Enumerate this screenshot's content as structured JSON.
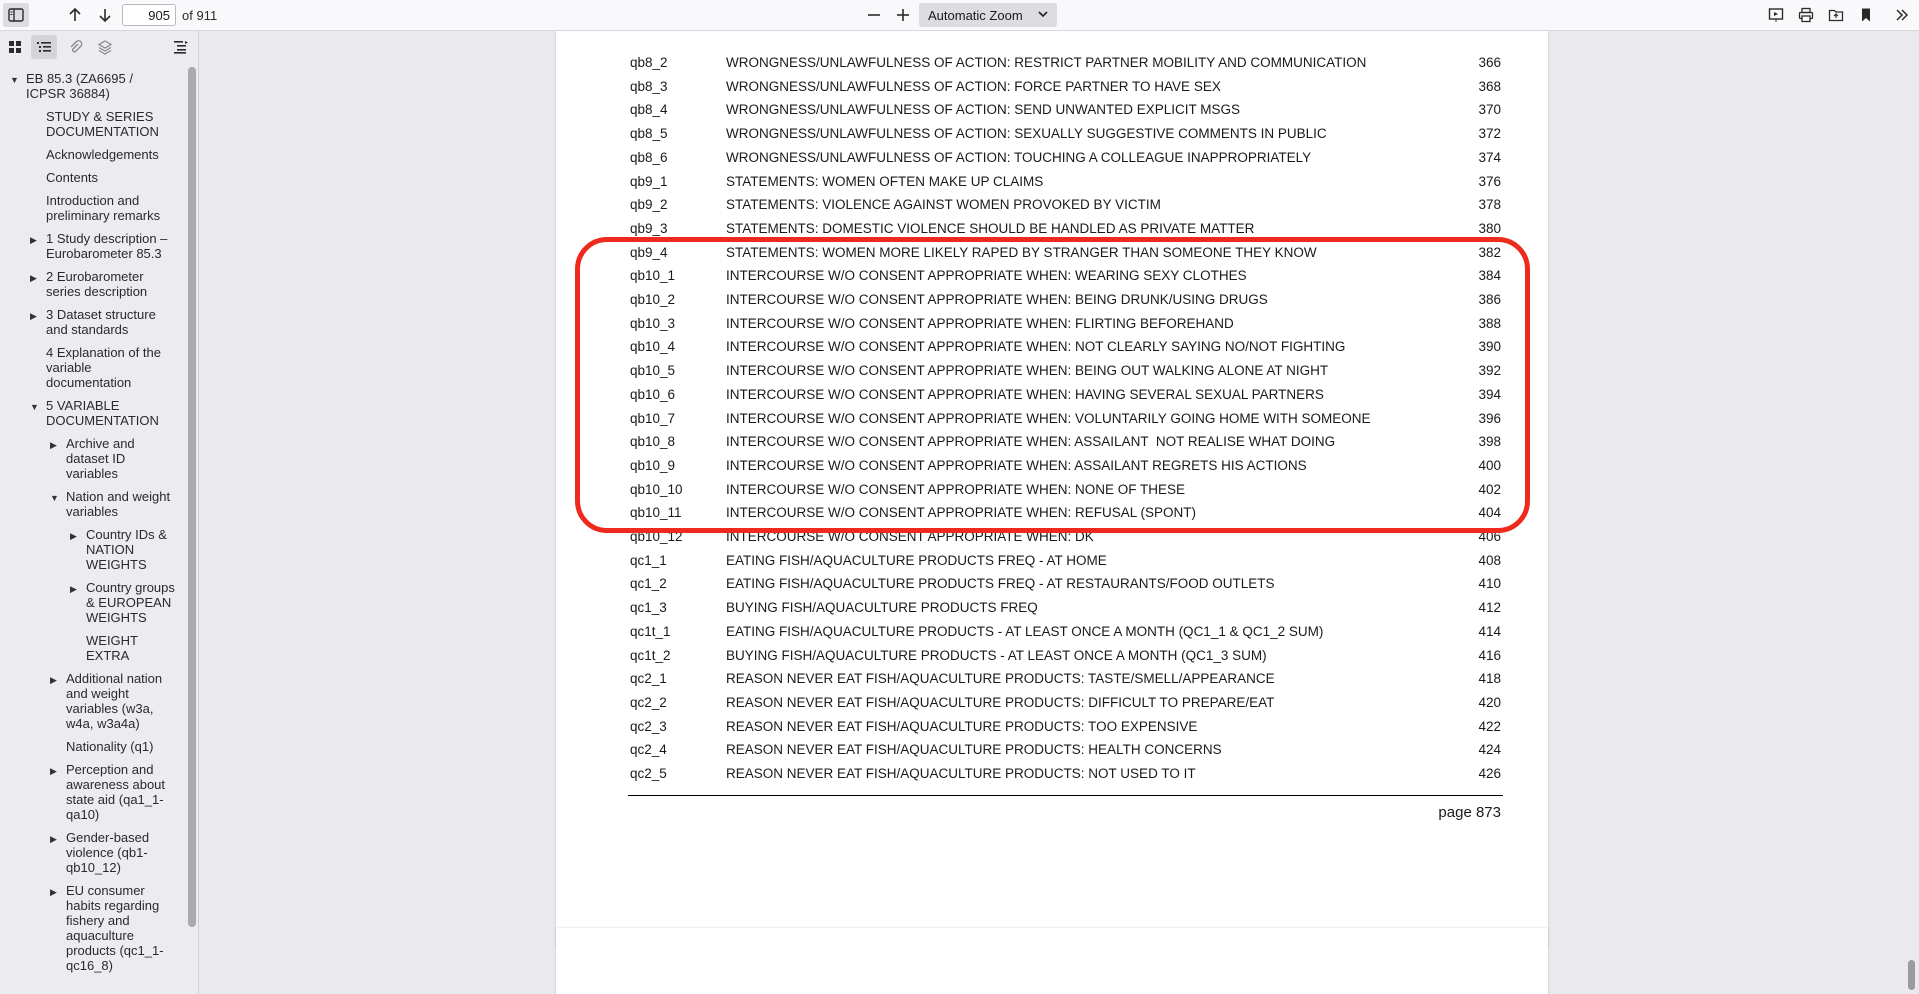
{
  "toolbar": {
    "page_number": "905",
    "page_count": "of 911",
    "zoom": "Automatic Zoom",
    "icons": {
      "sidebar_toggle": "sidebar-toggle-icon",
      "prev": "arrow-up-icon",
      "next": "arrow-down-icon",
      "zoom_out": "minus-icon",
      "zoom_in": "plus-icon",
      "presentation": "presentation-icon",
      "print": "print-icon",
      "open": "open-file-icon",
      "bookmark": "bookmark-icon",
      "tools": "double-chevron-icon"
    }
  },
  "sidebar": {
    "tabs": [
      "thumbnails-icon",
      "outline-icon",
      "attachments-icon",
      "layers-icon"
    ],
    "outline": [
      {
        "label": "EB 85.3 (ZA6695 / ICPSR 36884)",
        "level": 0,
        "twisty": "open"
      },
      {
        "label": "STUDY & SERIES DOCUMENTATION",
        "level": 1,
        "twisty": "none"
      },
      {
        "label": "Acknowledgements",
        "level": 1,
        "twisty": "none"
      },
      {
        "label": "Contents",
        "level": 1,
        "twisty": "none"
      },
      {
        "label": "Introduction and preliminary remarks",
        "level": 1,
        "twisty": "none"
      },
      {
        "label": "1 Study description – Eurobarometer 85.3",
        "level": 1,
        "twisty": "closed"
      },
      {
        "label": "2 Eurobarometer series description",
        "level": 1,
        "twisty": "closed"
      },
      {
        "label": "3 Dataset structure and standards",
        "level": 1,
        "twisty": "closed"
      },
      {
        "label": "4 Explanation of the variable documentation",
        "level": 1,
        "twisty": "none"
      },
      {
        "label": "5 VARIABLE DOCUMENTATION",
        "level": 1,
        "twisty": "open"
      },
      {
        "label": "Archive and dataset ID variables",
        "level": 2,
        "twisty": "closed"
      },
      {
        "label": "Nation and weight variables",
        "level": 2,
        "twisty": "open"
      },
      {
        "label": "Country IDs & NATION WEIGHTS",
        "level": 3,
        "twisty": "closed"
      },
      {
        "label": "Country groups & EUROPEAN WEIGHTS",
        "level": 3,
        "twisty": "closed"
      },
      {
        "label": "WEIGHT EXTRA",
        "level": 3,
        "twisty": "none"
      },
      {
        "label": "Additional nation and weight variables (w3a, w4a, w3a4a)",
        "level": 2,
        "twisty": "closed"
      },
      {
        "label": "Nationality (q1)",
        "level": 2,
        "twisty": "none"
      },
      {
        "label": "Perception and awareness about state aid (qa1_1-qa10)",
        "level": 2,
        "twisty": "closed"
      },
      {
        "label": "Gender-based violence (qb1-qb10_12)",
        "level": 2,
        "twisty": "closed"
      },
      {
        "label": "EU consumer habits regarding fishery and aquaculture products (qc1_1-qc16_8)",
        "level": 2,
        "twisty": "closed"
      }
    ]
  },
  "document": {
    "rows": [
      {
        "var": "qb8_2",
        "label": "WRONGNESS/UNLAWFULNESS OF ACTION: RESTRICT PARTNER MOBILITY AND COMMUNICATION",
        "page": "366"
      },
      {
        "var": "qb8_3",
        "label": "WRONGNESS/UNLAWFULNESS OF ACTION: FORCE PARTNER TO HAVE SEX",
        "page": "368"
      },
      {
        "var": "qb8_4",
        "label": "WRONGNESS/UNLAWFULNESS OF ACTION: SEND UNWANTED EXPLICIT MSGS",
        "page": "370"
      },
      {
        "var": "qb8_5",
        "label": "WRONGNESS/UNLAWFULNESS OF ACTION: SEXUALLY SUGGESTIVE COMMENTS IN PUBLIC",
        "page": "372"
      },
      {
        "var": "qb8_6",
        "label": "WRONGNESS/UNLAWFULNESS OF ACTION: TOUCHING A COLLEAGUE INAPPROPRIATELY",
        "page": "374"
      },
      {
        "var": "qb9_1",
        "label": "STATEMENTS: WOMEN OFTEN MAKE UP CLAIMS",
        "page": "376"
      },
      {
        "var": "qb9_2",
        "label": "STATEMENTS: VIOLENCE AGAINST WOMEN PROVOKED BY VICTIM",
        "page": "378"
      },
      {
        "var": "qb9_3",
        "label": "STATEMENTS: DOMESTIC VIOLENCE SHOULD BE HANDLED AS PRIVATE MATTER",
        "page": "380"
      },
      {
        "var": "qb9_4",
        "label": "STATEMENTS: WOMEN MORE LIKELY RAPED BY STRANGER THAN SOMEONE THEY KNOW",
        "page": "382"
      },
      {
        "var": "qb10_1",
        "label": "INTERCOURSE W/O CONSENT APPROPRIATE WHEN: WEARING SEXY CLOTHES",
        "page": "384"
      },
      {
        "var": "qb10_2",
        "label": "INTERCOURSE W/O CONSENT APPROPRIATE WHEN: BEING DRUNK/USING DRUGS",
        "page": "386"
      },
      {
        "var": "qb10_3",
        "label": "INTERCOURSE W/O CONSENT APPROPRIATE WHEN: FLIRTING BEFOREHAND",
        "page": "388"
      },
      {
        "var": "qb10_4",
        "label": "INTERCOURSE W/O CONSENT APPROPRIATE WHEN: NOT CLEARLY SAYING NO/NOT FIGHTING",
        "page": "390"
      },
      {
        "var": "qb10_5",
        "label": "INTERCOURSE W/O CONSENT APPROPRIATE WHEN: BEING OUT WALKING ALONE AT NIGHT",
        "page": "392"
      },
      {
        "var": "qb10_6",
        "label": "INTERCOURSE W/O CONSENT APPROPRIATE WHEN: HAVING SEVERAL SEXUAL PARTNERS",
        "page": "394"
      },
      {
        "var": "qb10_7",
        "label": "INTERCOURSE W/O CONSENT APPROPRIATE WHEN: VOLUNTARILY GOING HOME WITH SOMEONE",
        "page": "396"
      },
      {
        "var": "qb10_8",
        "label": "INTERCOURSE W/O CONSENT APPROPRIATE WHEN: ASSAILANT  NOT REALISE WHAT DOING",
        "page": "398"
      },
      {
        "var": "qb10_9",
        "label": "INTERCOURSE W/O CONSENT APPROPRIATE WHEN: ASSAILANT REGRETS HIS ACTIONS",
        "page": "400"
      },
      {
        "var": "qb10_10",
        "label": "INTERCOURSE W/O CONSENT APPROPRIATE WHEN: NONE OF THESE",
        "page": "402"
      },
      {
        "var": "qb10_11",
        "label": "INTERCOURSE W/O CONSENT APPROPRIATE WHEN: REFUSAL (SPONT)",
        "page": "404"
      },
      {
        "var": "qb10_12",
        "label": "INTERCOURSE W/O CONSENT APPROPRIATE WHEN: DK",
        "page": "406"
      },
      {
        "var": "qc1_1",
        "label": "EATING FISH/AQUACULTURE PRODUCTS FREQ - AT HOME",
        "page": "408"
      },
      {
        "var": "qc1_2",
        "label": "EATING FISH/AQUACULTURE PRODUCTS FREQ - AT RESTAURANTS/FOOD OUTLETS",
        "page": "410"
      },
      {
        "var": "qc1_3",
        "label": "BUYING FISH/AQUACULTURE PRODUCTS FREQ",
        "page": "412"
      },
      {
        "var": "qc1t_1",
        "label": "EATING FISH/AQUACULTURE PRODUCTS - AT LEAST ONCE A MONTH (QC1_1 & QC1_2 SUM)",
        "page": "414"
      },
      {
        "var": "qc1t_2",
        "label": "BUYING FISH/AQUACULTURE PRODUCTS - AT LEAST ONCE A MONTH (QC1_3 SUM)",
        "page": "416"
      },
      {
        "var": "qc2_1",
        "label": "REASON NEVER EAT FISH/AQUACULTURE PRODUCTS: TASTE/SMELL/APPEARANCE",
        "page": "418"
      },
      {
        "var": "qc2_2",
        "label": "REASON NEVER EAT FISH/AQUACULTURE PRODUCTS: DIFFICULT TO PREPARE/EAT",
        "page": "420"
      },
      {
        "var": "qc2_3",
        "label": "REASON NEVER EAT FISH/AQUACULTURE PRODUCTS: TOO EXPENSIVE",
        "page": "422"
      },
      {
        "var": "qc2_4",
        "label": "REASON NEVER EAT FISH/AQUACULTURE PRODUCTS: HEALTH CONCERNS",
        "page": "424"
      },
      {
        "var": "qc2_5",
        "label": "REASON NEVER EAT FISH/AQUACULTURE PRODUCTS: NOT USED TO IT",
        "page": "426"
      }
    ],
    "footer_page": "page 873",
    "highlight_color": "#ee2a1c"
  }
}
